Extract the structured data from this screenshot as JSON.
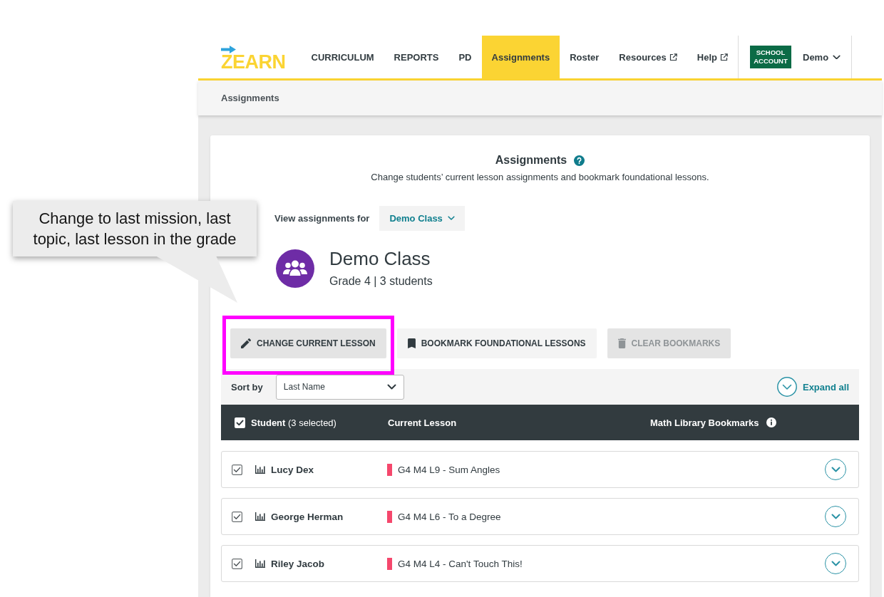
{
  "nav": {
    "logo": "ZEARN",
    "items": [
      {
        "label": "CURRICULUM",
        "selected": false,
        "external": false
      },
      {
        "label": "REPORTS",
        "selected": false,
        "external": false
      },
      {
        "label": "PD",
        "selected": false,
        "external": false
      },
      {
        "label": "Assignments",
        "selected": true,
        "external": false
      },
      {
        "label": "Roster",
        "selected": false,
        "external": false
      },
      {
        "label": "Resources",
        "selected": false,
        "external": true
      },
      {
        "label": "Help",
        "selected": false,
        "external": true
      }
    ],
    "badge": "SCHOOL ACCOUNT",
    "user": "Demo"
  },
  "breadcrumb": "Assignments",
  "header": {
    "title": "Assignments",
    "subtitle": "Change students’ current lesson assignments and bookmark foundational lessons."
  },
  "class_picker": {
    "label": "View assignments for",
    "value": "Demo Class"
  },
  "class_info": {
    "name": "Demo Class",
    "details": "Grade 4 | 3 students"
  },
  "buttons": [
    {
      "label": "CHANGE CURRENT LESSON",
      "highlighted": true,
      "disabled": false
    },
    {
      "label": "BOOKMARK FOUNDATIONAL LESSONS",
      "highlighted": false,
      "disabled": false
    },
    {
      "label": "CLEAR BOOKMARKS",
      "highlighted": false,
      "disabled": true
    }
  ],
  "sort": {
    "label": "Sort by",
    "value": "Last Name",
    "expand_all": "Expand all"
  },
  "table": {
    "all_checked": true,
    "columns": [
      "**Student** (3 selected)",
      "Current Lesson",
      "Math Library Bookmarks"
    ],
    "rows": [
      {
        "checked": true,
        "name": "Lucy Dex",
        "lesson": "G4 M4 L9 - Sum Angles",
        "color": "#f5476c"
      },
      {
        "checked": true,
        "name": "George Herman",
        "lesson": "G4 M4 L6 - To a Degree",
        "color": "#f5476c"
      },
      {
        "checked": true,
        "name": "Riley Jacob",
        "lesson": "G4 M4 L4 - Can't Touch This!",
        "color": "#f5476c"
      }
    ]
  },
  "callout": {
    "text": "Change to last mission, last topic, last lesson in the grade"
  }
}
